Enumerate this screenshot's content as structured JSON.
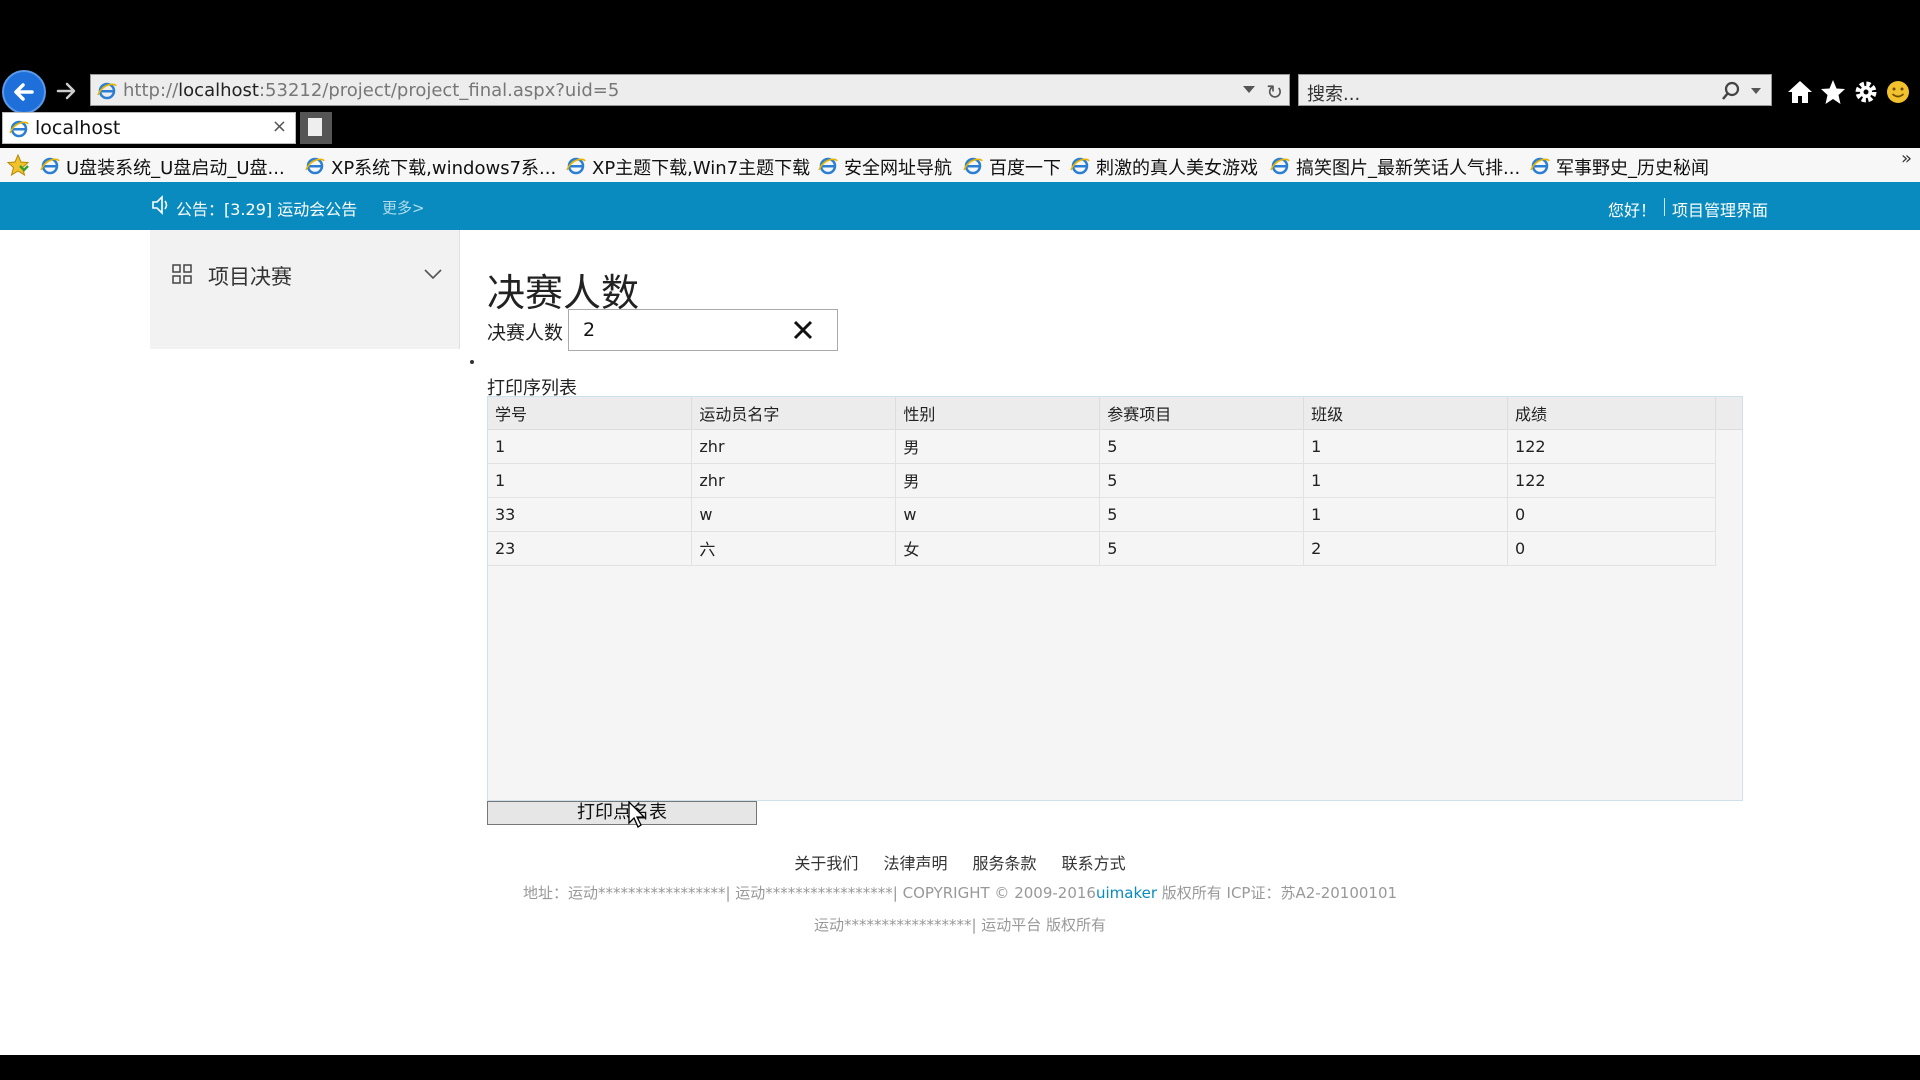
{
  "browser": {
    "url_prefix": "http://",
    "url_host": "localhost",
    "url_rest": ":53212/project/project_final.aspx?uid=5",
    "search_placeholder": "搜索...",
    "tab_title": "localhost",
    "tab_close": "×",
    "favorites": [
      "U盘装系统_U盘启动_U盘...",
      "XP系统下载,windows7系...",
      "XP主题下载,Win7主题下载",
      "安全网址导航",
      "百度一下",
      "刺激的真人美女游戏",
      "搞笑图片_最新笑话人气排...",
      "军事野史_历史秘闻"
    ],
    "fav_more": "»"
  },
  "topbar": {
    "notice": "公告：[3.29] 运动会公告",
    "more": "更多>",
    "greeting": "您好！",
    "admin_link": "项目管理界面",
    "bg_color": "#0a8bbf"
  },
  "sidebar": {
    "item_label": "项目决赛"
  },
  "main": {
    "title": "决赛人数",
    "count_label": "决赛人数",
    "count_value": "2",
    "list_title": "打印序列表",
    "columns": [
      "学号",
      "运动员名字",
      "性别",
      "参赛项目",
      "班级",
      "成绩"
    ],
    "rows": [
      [
        "1",
        "zhr",
        "男",
        "5",
        "1",
        "122"
      ],
      [
        "1",
        "zhr",
        "男",
        "5",
        "1",
        "122"
      ],
      [
        "33",
        "w",
        "w",
        "5",
        "1",
        "0"
      ],
      [
        "23",
        "六",
        "女",
        "5",
        "2",
        "0"
      ]
    ],
    "print_button": "打印点名表"
  },
  "footer": {
    "links": [
      "关于我们",
      "法律声明",
      "服务条款",
      "联系方式"
    ],
    "line1_prefix": "地址：运动*****************| 运动*****************| COPYRIGHT © 2009-2016",
    "line1_brand": "uimaker",
    "line1_suffix": " 版权所有 ICP证：苏A2-20100101",
    "line2": "运动*****************| 运动平台 版权所有"
  }
}
